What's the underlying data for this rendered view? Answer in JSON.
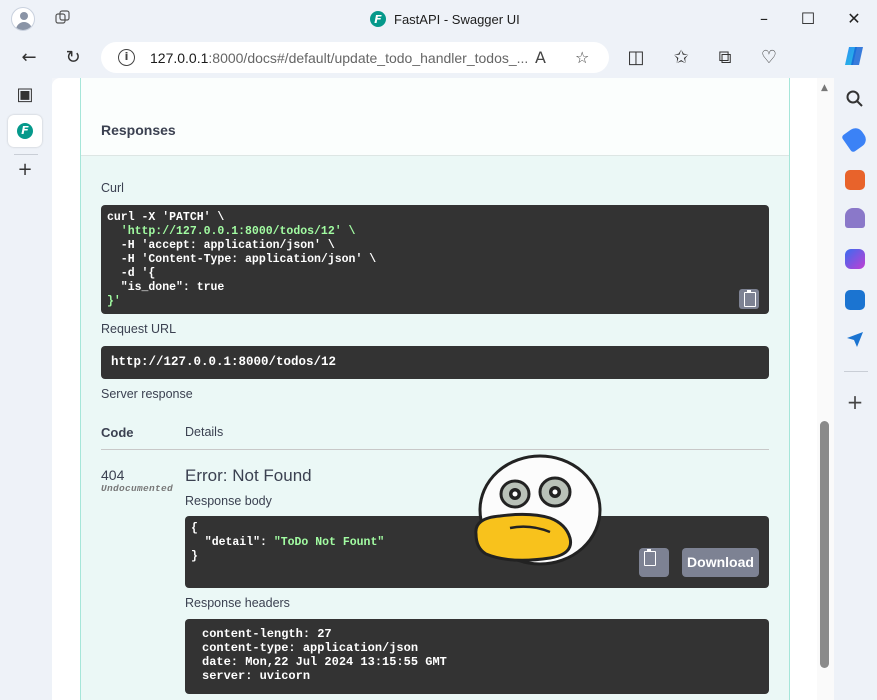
{
  "browser": {
    "window_title": "FastAPI - Swagger UI",
    "url_host": "127.0.0.1",
    "url_rest": ":8000/docs#/default/update_todo_handler_todos_...",
    "favicon_letter": "F"
  },
  "responses": {
    "title": "Responses",
    "curl_label": "Curl",
    "curl_lines": [
      "curl -X 'PATCH' \\",
      "  'http://127.0.0.1:8000/todos/12' \\",
      "  -H 'accept: application/json' \\",
      "  -H 'Content-Type: application/json' \\",
      "  -d '{",
      "  \"is_done\": true",
      "}'"
    ],
    "request_url_label": "Request URL",
    "request_url": "http://127.0.0.1:8000/todos/12",
    "server_response_label": "Server response",
    "col_code": "Code",
    "col_details": "Details",
    "status_code": "404",
    "undocumented": "Undocumented",
    "error_text": "Error: Not Found",
    "response_body_label": "Response body",
    "response_body_lines": [
      "{",
      "  \"detail\": \"ToDo Not Fount\"",
      "}"
    ],
    "download_label": "Download",
    "response_headers_label": "Response headers",
    "response_headers": [
      "content-length: 27",
      "content-type: application/json",
      "date: Mon,22 Jul 2024 13:15:55 GMT",
      "server: uvicorn"
    ]
  },
  "icons": {
    "titlebar": [
      "profile-avatar-icon",
      "workspaces-icon",
      "fastapi-favicon-icon",
      "minimize-icon",
      "maximize-icon",
      "close-icon"
    ],
    "navbar": [
      "back-icon",
      "refresh-icon",
      "site-info-icon",
      "read-aloud-icon",
      "favorite-star-icon",
      "split-screen-icon",
      "favorites-icon",
      "collections-icon",
      "browser-essentials-icon",
      "copilot-icon"
    ],
    "right_sidebar": [
      "search-icon",
      "shopping-tag-icon",
      "tools-icon",
      "games-icon",
      "microsoft365-icon",
      "outlook-icon",
      "send-icon",
      "add-icon"
    ]
  },
  "colors": {
    "browser_chrome": "#eef2f8",
    "swagger_patch_bg": "#ebf8f6",
    "swagger_patch_border": "#a6e6d9",
    "code_bg": "#333333",
    "code_string": "#a2fca2",
    "button_gray": "#7d8293",
    "favicon_teal": "#05998b"
  }
}
